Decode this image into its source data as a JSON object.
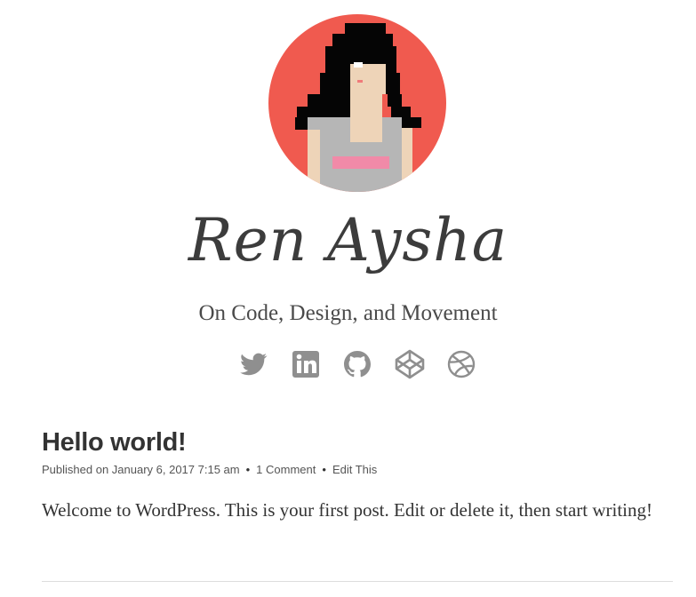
{
  "site": {
    "title": "Ren Aysha",
    "tagline": "On Code, Design, and Movement",
    "avatar_bg": "#f05a4f"
  },
  "social": [
    {
      "icon": "twitter-icon"
    },
    {
      "icon": "linkedin-icon"
    },
    {
      "icon": "github-icon"
    },
    {
      "icon": "codepen-icon"
    },
    {
      "icon": "dribbble-icon"
    }
  ],
  "post": {
    "title": "Hello world!",
    "published_label": "Published on January 6, 2017 7:15 am",
    "comments_link": "1 Comment",
    "edit_link": "Edit This",
    "separator": "•",
    "body": "Welcome to WordPress. This is your first post. Edit or delete it, then start writing!"
  },
  "colors": {
    "icon": "#8f8f8f",
    "text": "#333333"
  }
}
